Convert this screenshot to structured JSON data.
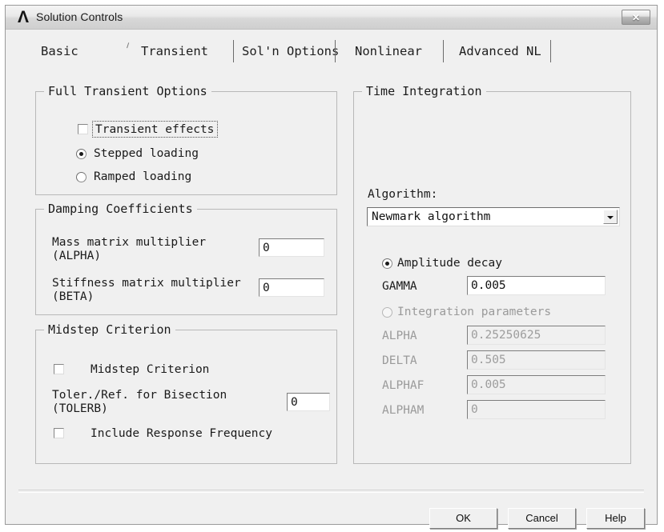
{
  "window": {
    "title": "Solution Controls",
    "logo_glyph": "Λ",
    "close_glyph": "✕"
  },
  "tabs": [
    {
      "label": "Basic",
      "active": false
    },
    {
      "label": "Transient",
      "active": true
    },
    {
      "label": "Sol'n Options",
      "active": false
    },
    {
      "label": "Nonlinear",
      "active": false
    },
    {
      "label": "Advanced NL",
      "active": false
    }
  ],
  "full_transient_options": {
    "title": "Full Transient Options",
    "transient_effects": {
      "label": "Transient effects",
      "checked": false,
      "focused": true
    },
    "stepped_loading": {
      "label": "Stepped loading",
      "selected": true
    },
    "ramped_loading": {
      "label": "Ramped loading",
      "selected": false
    }
  },
  "damping_coefficients": {
    "title": "Damping Coefficients",
    "mass_label_line1": "Mass matrix multiplier",
    "mass_label_line2": "(ALPHA)",
    "mass_value": "0",
    "stiffness_label_line1": "Stiffness matrix multiplier",
    "stiffness_label_line2": "(BETA)",
    "stiffness_value": "0"
  },
  "midstep_criterion": {
    "title": "Midstep Criterion",
    "midstep_checkbox_label": "Midstep Criterion",
    "midstep_checked": false,
    "tolerb_label_line1": "Toler./Ref. for Bisection",
    "tolerb_label_line2": "(TOLERB)",
    "tolerb_value": "0",
    "response_freq_label": "Include Response Frequency",
    "response_freq_checked": false
  },
  "time_integration": {
    "title": "Time Integration",
    "algorithm_label": "Algorithm:",
    "algorithm_value": "Newmark algorithm",
    "amplitude_decay": {
      "label": "Amplitude decay",
      "selected": true
    },
    "gamma_label": "GAMMA",
    "gamma_value": "0.005",
    "integration_parameters": {
      "label": "Integration parameters",
      "selected": false
    },
    "alpha_label": "ALPHA",
    "alpha_value": "0.25250625",
    "delta_label": "DELTA",
    "delta_value": "0.505",
    "alphaf_label": "ALPHAF",
    "alphaf_value": "0.005",
    "alpham_label": "ALPHAM",
    "alpham_value": "0"
  },
  "buttons": {
    "ok": "OK",
    "cancel": "Cancel",
    "help": "Help"
  }
}
